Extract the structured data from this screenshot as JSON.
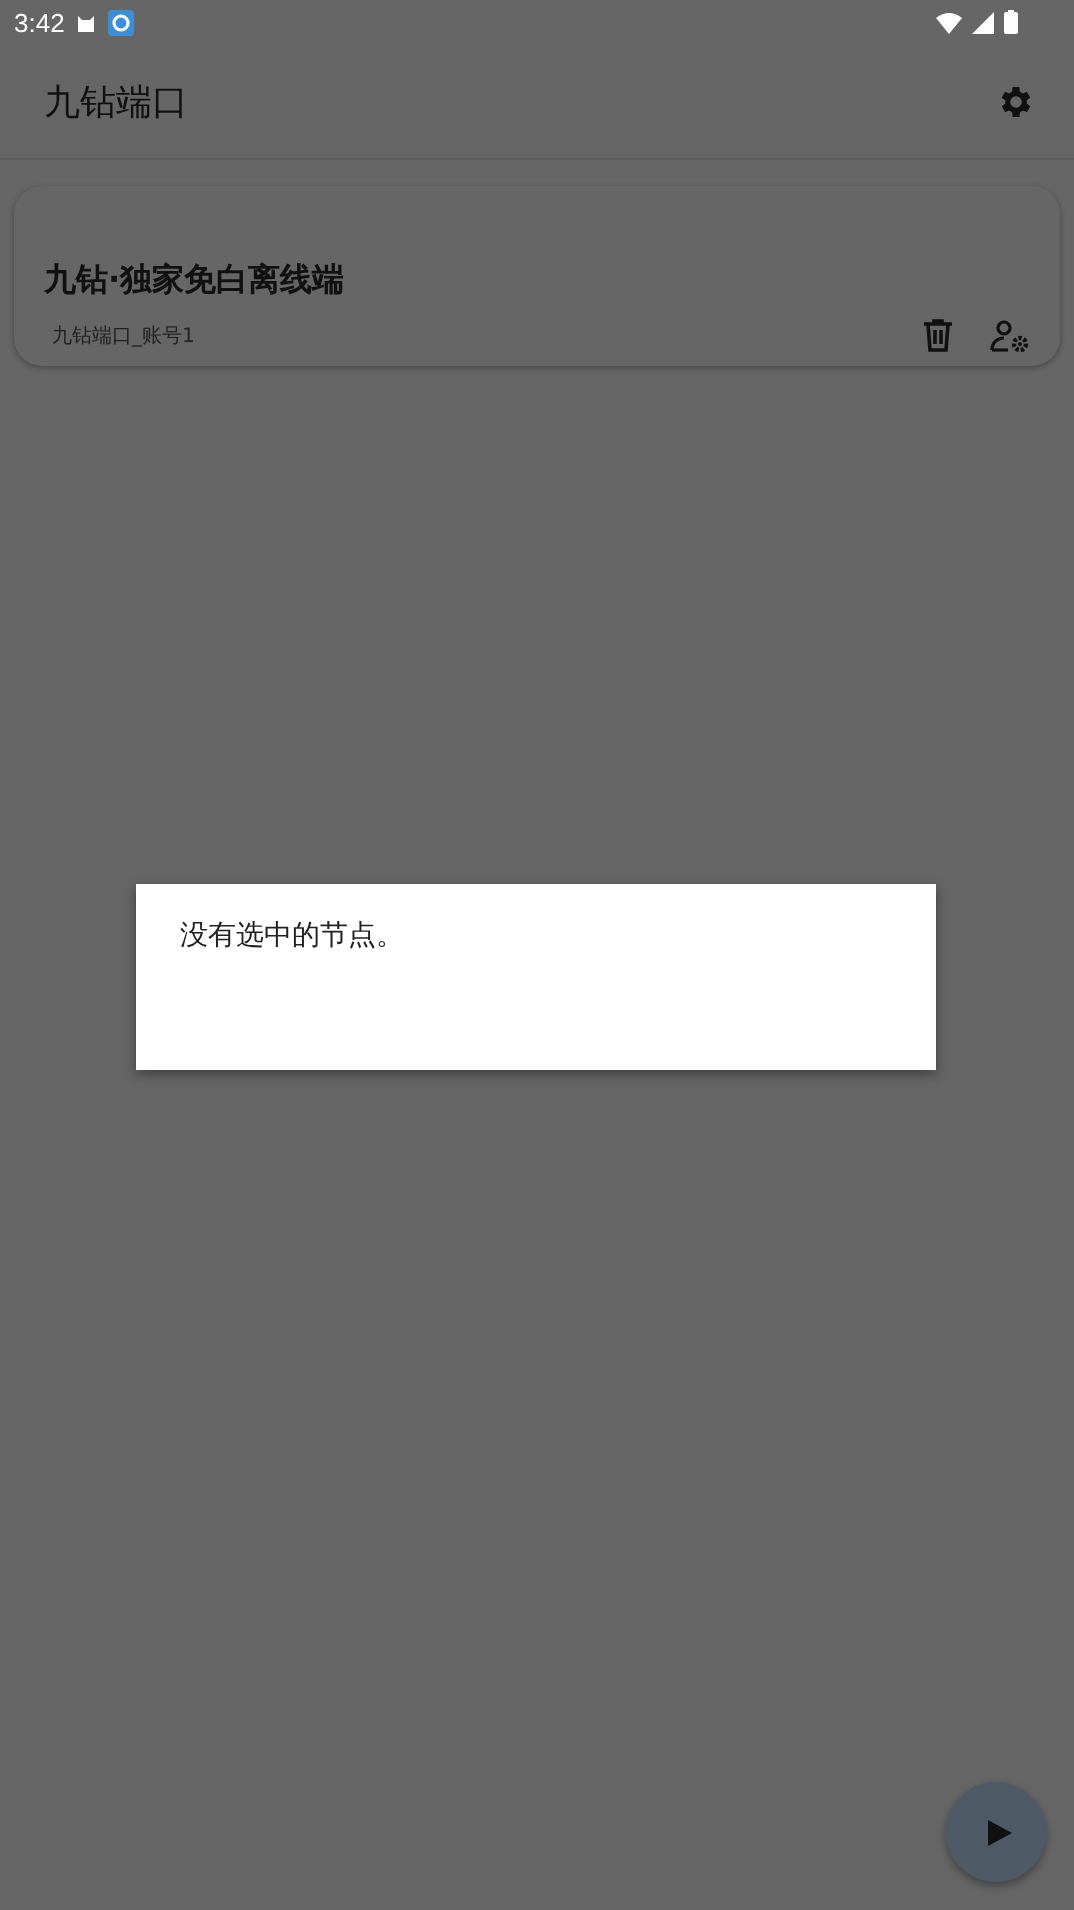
{
  "status_bar": {
    "time": "3:42"
  },
  "app_bar": {
    "title": "九钻端口"
  },
  "cards": [
    {
      "title": "九钻·独家免白离线端",
      "subtitle": "九钻端口_账号1"
    }
  ],
  "dialog": {
    "message": "没有选中的节点。"
  }
}
